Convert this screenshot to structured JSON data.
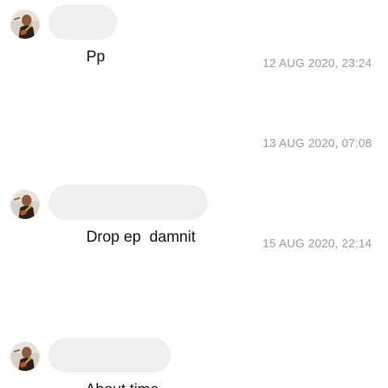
{
  "conversation": {
    "messages": [
      {
        "sender": "avatar",
        "text": "Pp"
      },
      {
        "sender": "avatar",
        "text": "Drop ep  damnit"
      },
      {
        "sender": "avatar",
        "text": "About time"
      }
    ],
    "timestamps": [
      "12 AUG 2020, 23:24",
      "13 AUG 2020, 07:08",
      "15 AUG 2020, 22:14"
    ]
  },
  "colors": {
    "bubble_background": "#efefef",
    "timestamp_text": "#9a9a9a",
    "message_text": "#111111",
    "background": "#ffffff"
  },
  "icons": {
    "avatar": "profile-photo-guitarist"
  }
}
